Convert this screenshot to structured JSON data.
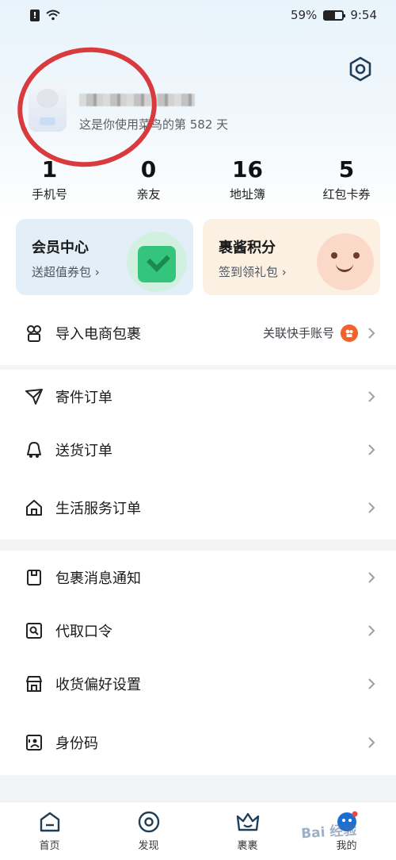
{
  "status_bar": {
    "battery": "59%",
    "time": "9:54",
    "battery_level": 0.59
  },
  "profile": {
    "days_text": "这是你使用菜鸟的第 582 天"
  },
  "stats": [
    {
      "value": "1",
      "label": "手机号"
    },
    {
      "value": "0",
      "label": "亲友"
    },
    {
      "value": "16",
      "label": "地址簿"
    },
    {
      "value": "5",
      "label": "红包卡券"
    }
  ],
  "cards": {
    "member": {
      "title": "会员中心",
      "subtitle": "送超值券包 ›"
    },
    "points": {
      "title": "裹酱积分",
      "subtitle": "签到领礼包 ›"
    }
  },
  "import_row": {
    "label": "导入电商包裹",
    "extra": "关联快手账号"
  },
  "orders": [
    {
      "label": "寄件订单",
      "icon": "send-icon"
    },
    {
      "label": "送货订单",
      "icon": "delivery-icon"
    },
    {
      "label": "生活服务订单",
      "icon": "home-icon"
    }
  ],
  "settings": [
    {
      "label": "包裹消息通知",
      "icon": "notification-icon"
    },
    {
      "label": "代取口令",
      "icon": "pickup-code-icon"
    },
    {
      "label": "收货偏好设置",
      "icon": "store-icon"
    },
    {
      "label": "身份码",
      "icon": "id-code-icon"
    }
  ],
  "tabs": [
    {
      "label": "首页",
      "icon": "home-tab-icon"
    },
    {
      "label": "发现",
      "icon": "discover-icon"
    },
    {
      "label": "裹裹",
      "icon": "guoguo-icon"
    },
    {
      "label": "我的",
      "icon": "profile-icon"
    }
  ],
  "watermark": "Bai 经验"
}
